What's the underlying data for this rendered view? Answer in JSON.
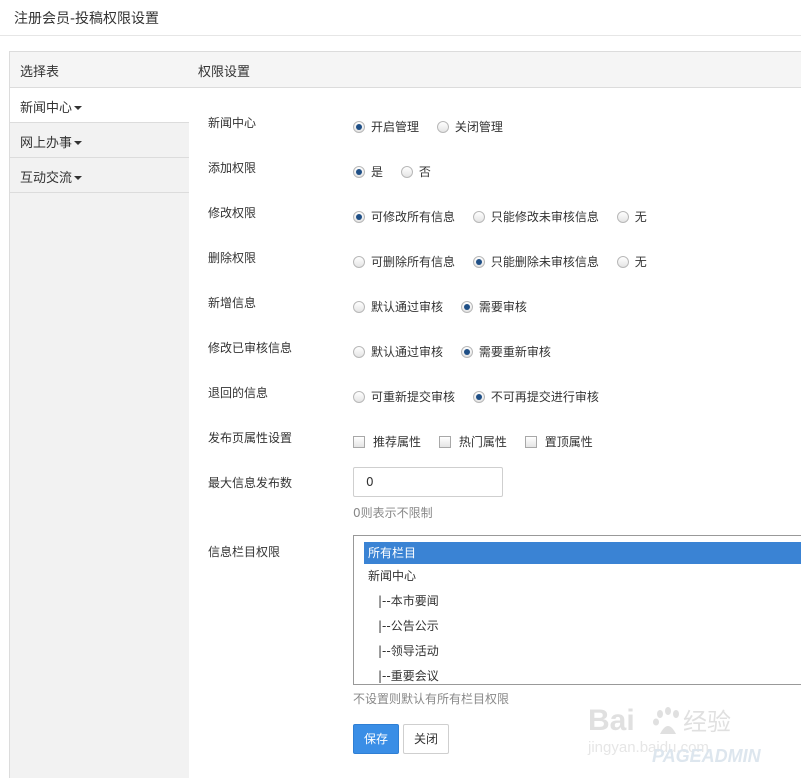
{
  "header": {
    "title": "注册会员-投稿权限设置"
  },
  "sidebar": {
    "title": "选择表",
    "items": [
      {
        "label": "新闻中心",
        "active": true
      },
      {
        "label": "网上办事",
        "active": false
      },
      {
        "label": "互动交流",
        "active": false
      }
    ]
  },
  "main": {
    "title": "权限设置",
    "rows": [
      {
        "label": "新闻中心",
        "options": [
          "开启管理",
          "关闭管理"
        ],
        "selected": 0
      },
      {
        "label": "添加权限",
        "options": [
          "是",
          "否"
        ],
        "selected": 0
      },
      {
        "label": "修改权限",
        "options": [
          "可修改所有信息",
          "只能修改未审核信息",
          "无"
        ],
        "selected": 0
      },
      {
        "label": "删除权限",
        "options": [
          "可删除所有信息",
          "只能删除未审核信息",
          "无"
        ],
        "selected": 1
      },
      {
        "label": "新增信息",
        "options": [
          "默认通过审核",
          "需要审核"
        ],
        "selected": 1
      },
      {
        "label": "修改已审核信息",
        "options": [
          "默认通过审核",
          "需要重新审核"
        ],
        "selected": 1
      },
      {
        "label": "退回的信息",
        "options": [
          "可重新提交审核",
          "不可再提交进行审核"
        ],
        "selected": 1
      }
    ],
    "attributes": {
      "label": "发布页属性设置",
      "checkboxes": [
        "推荐属性",
        "热门属性",
        "置顶属性"
      ]
    },
    "max_posts": {
      "label": "最大信息发布数",
      "value": "0",
      "hint": "0则表示不限制"
    },
    "columns": {
      "label": "信息栏目权限",
      "items": [
        {
          "text": "所有栏目",
          "selected": true
        },
        {
          "text": "新闻中心",
          "selected": false
        },
        {
          "text": "|--本市要闻",
          "selected": false
        },
        {
          "text": "|--公告公示",
          "selected": false
        },
        {
          "text": "|--领导活动",
          "selected": false
        },
        {
          "text": "|--重要会议",
          "selected": false
        }
      ],
      "hint": "不设置则默认有所有栏目权限"
    },
    "buttons": {
      "save": "保存",
      "close": "关闭"
    }
  },
  "watermark": {
    "brand": "Baidu经验",
    "url": "jingyan.baidu.com",
    "overlay": "PAGEADMIN"
  }
}
